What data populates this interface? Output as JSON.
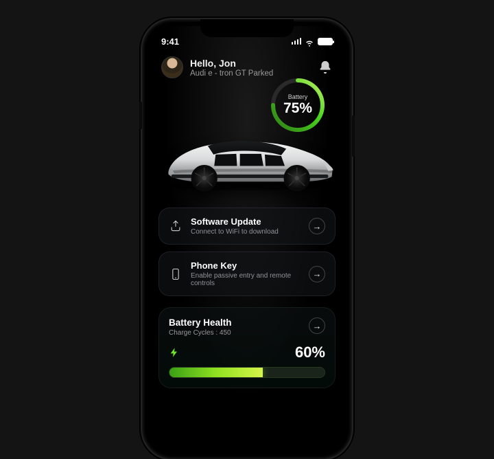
{
  "status": {
    "time": "9:41"
  },
  "header": {
    "greeting": "Hello, Jon",
    "vehicle_status": "Audi e - tron GT Parked"
  },
  "battery_ring": {
    "label": "Battery",
    "percent_text": "75%",
    "percent": 75,
    "color": "#3cc72a"
  },
  "cards": {
    "software": {
      "title": "Software Update",
      "subtitle": "Connect to WiFi to download"
    },
    "phone_key": {
      "title": "Phone Key",
      "subtitle": "Enable passive entry and remote controls"
    }
  },
  "battery_health": {
    "title": "Battery Health",
    "cycles_label": "Charge Cycles : 450",
    "percent_text": "60%",
    "percent": 60
  }
}
